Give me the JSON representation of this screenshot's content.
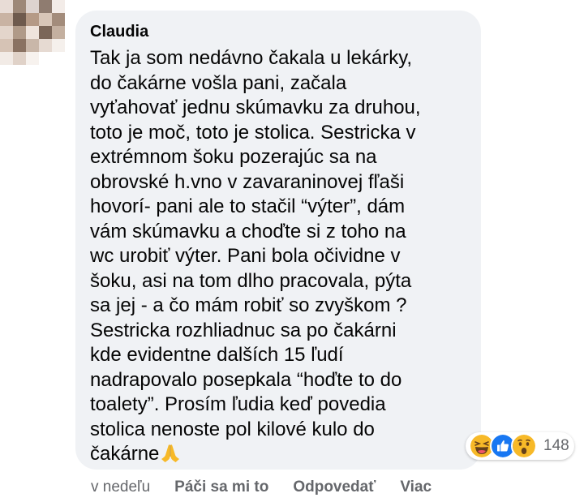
{
  "comment": {
    "author": "Claudia",
    "lines": [
      "Tak ja som nedávno čakala u lekárky,",
      "do čakárne vošla pani, začala",
      "vyťahovať jednu skúmavku za druhou,",
      "toto je moč, toto je stolica. Sestricka v",
      "extrémnom šoku pozerajúc sa na",
      "obrovské h.vno v zavaraninovej fľaši",
      "hovorí- pani ale to stačil “výter”, dám",
      "vám skúmavku a choďte si z toho na",
      "wc urobiť výter. Pani bola očividne v",
      "šoku, asi na tom dlho pracovala, pýta",
      "sa jej - a čo mám robiť so zvyškom ?",
      "Sestricka rozhliadnuc sa po čakárni",
      "kde evidentne dalších 15 ľudí",
      "nadrapovalo posepkala “hoďte to do",
      "toalety”. Prosím ľudia keď povedia",
      "stolica nenoste pol kilové kulo do",
      "čakárne"
    ],
    "emoji": "folded-hands",
    "reactions": {
      "icons": [
        "laugh-react-icon",
        "like-react-icon",
        "wow-react-icon"
      ],
      "count": "148"
    }
  },
  "actions": {
    "time": "v nedeľu",
    "like": "Páči sa mi to",
    "reply": "Odpovedať",
    "more": "Viac"
  },
  "colors": {
    "bubble": "#f0f2f5",
    "text": "#050505",
    "secondary": "#65676b",
    "like_blue": "#1877f2",
    "emoji_yellow": "#f7b928"
  }
}
